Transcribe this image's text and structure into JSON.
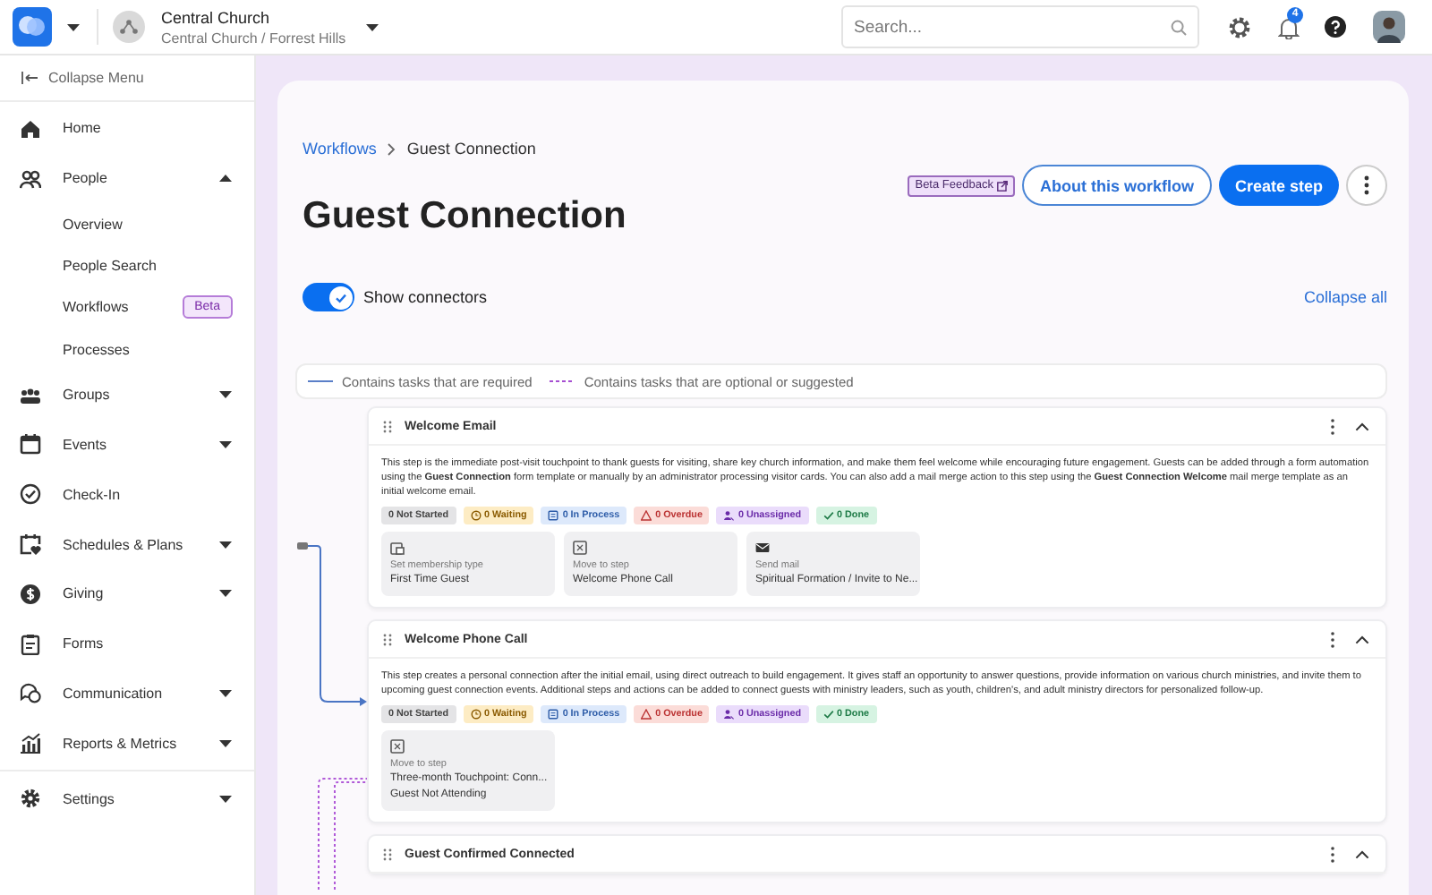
{
  "header": {
    "org_name": "Central Church",
    "org_path": "Central Church / Forrest Hills",
    "search": {
      "placeholder": "Search..."
    },
    "notification_count": "4"
  },
  "sidebar": {
    "collapse_label": "Collapse Menu",
    "items": [
      {
        "label": "Home",
        "kind": "home"
      },
      {
        "label": "People",
        "kind": "people",
        "expanded": true,
        "children": [
          {
            "label": "Overview"
          },
          {
            "label": "People Search"
          },
          {
            "label": "Workflows",
            "badge": "Beta"
          },
          {
            "label": "Processes"
          }
        ]
      },
      {
        "label": "Groups",
        "kind": "groups",
        "expanded": false
      },
      {
        "label": "Events",
        "kind": "events",
        "expanded": false
      },
      {
        "label": "Check-In",
        "kind": "checkin"
      },
      {
        "label": "Schedules & Plans",
        "kind": "schedules",
        "expanded": false
      },
      {
        "label": "Giving",
        "kind": "giving",
        "expanded": false
      },
      {
        "label": "Forms",
        "kind": "forms"
      },
      {
        "label": "Communication",
        "kind": "communication",
        "expanded": false
      },
      {
        "label": "Reports & Metrics",
        "kind": "reports",
        "expanded": false
      }
    ],
    "footer_items": [
      {
        "label": "Settings",
        "kind": "settings",
        "expanded": false
      }
    ]
  },
  "main": {
    "breadcrumb": [
      {
        "label": "Workflows",
        "kind": "link"
      },
      {
        "label": "Guest Connection",
        "kind": "current"
      }
    ],
    "title": "Guest Connection",
    "actions": {
      "beta_feedback": "Beta Feedback",
      "about": "About this workflow",
      "create": "Create step"
    },
    "show_connectors": {
      "label": "Show connectors",
      "on": true
    },
    "collapse_all": "Collapse all",
    "legend": [
      {
        "label": "Contains tasks that are required",
        "kind": "solid"
      },
      {
        "label": "Contains tasks that are optional or suggested",
        "kind": "dashed"
      }
    ],
    "steps": [
      {
        "title": "Welcome Email",
        "expanded": true,
        "description": "This step is the immediate post-visit touchpoint to thank guests for visiting, share key church information, and make them feel welcome while encouraging future engagement. Guests can be added through a form automation using the **Guest Connection** form template or manually by an administrator processing visitor cards. You can also add a mail merge action to this step using the **Guest Connection Welcome** mail merge template as an initial welcome email.",
        "statuses": [
          {
            "kind": "not_started",
            "label": "0 Not Started"
          },
          {
            "kind": "waiting",
            "label": "0 Waiting"
          },
          {
            "kind": "in_process",
            "label": "0 In Process"
          },
          {
            "kind": "overdue",
            "label": "0 Overdue"
          },
          {
            "kind": "unassigned",
            "label": "0 Unassigned"
          },
          {
            "kind": "done",
            "label": "0 Done"
          }
        ],
        "actions": [
          {
            "kind": "membership",
            "label": "Set membership type",
            "values": [
              "First Time Guest"
            ]
          },
          {
            "kind": "move",
            "label": "Move to step",
            "values": [
              "Welcome Phone Call"
            ]
          },
          {
            "kind": "mail",
            "label": "Send mail",
            "values": [
              "Spiritual Formation / Invite to Ne..."
            ]
          }
        ]
      },
      {
        "title": "Welcome Phone Call",
        "expanded": true,
        "description": "This step creates a personal connection after the initial email, using direct outreach to build engagement. It gives staff an opportunity to answer questions, provide information on various church ministries, and invite them to upcoming guest connection events. Additional steps and actions can be added to connect guests with ministry leaders, such as youth, children's, and adult ministry directors for personalized follow-up.",
        "statuses": [
          {
            "kind": "not_started",
            "label": "0 Not Started"
          },
          {
            "kind": "waiting",
            "label": "0 Waiting"
          },
          {
            "kind": "in_process",
            "label": "0 In Process"
          },
          {
            "kind": "overdue",
            "label": "0 Overdue"
          },
          {
            "kind": "unassigned",
            "label": "0 Unassigned"
          },
          {
            "kind": "done",
            "label": "0 Done"
          }
        ],
        "actions": [
          {
            "kind": "move",
            "label": "Move to step",
            "values": [
              "Three-month Touchpoint: Conn...",
              "Guest Not Attending"
            ]
          }
        ]
      },
      {
        "title": "Guest Confirmed Connected",
        "expanded": true
      }
    ]
  }
}
